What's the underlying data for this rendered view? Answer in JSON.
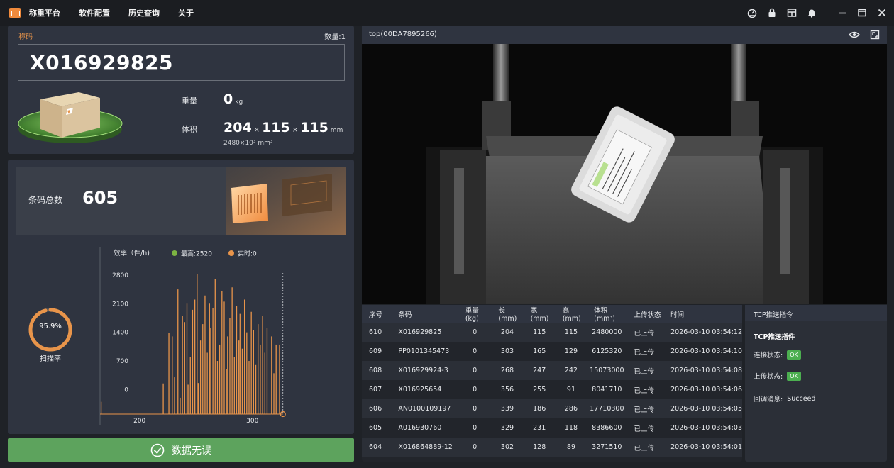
{
  "titlebar": {
    "menu": [
      "称重平台",
      "软件配置",
      "历史查询",
      "关于"
    ]
  },
  "barcode_panel": {
    "label": "称码",
    "count": "数量:1",
    "barcode": "X016929825",
    "weight_label": "重量",
    "weight_value": "0",
    "weight_unit": "kg",
    "volume_label": "体积",
    "length": "204",
    "width": "115",
    "height": "115",
    "dim_unit": "mm",
    "volume_sub": "2480×10³ mm³"
  },
  "stats": {
    "total_label": "条码总数",
    "total_value": "605",
    "scan_rate": "95.9%",
    "scan_rate_fraction": 0.959,
    "scan_rate_label": "扫描率"
  },
  "status_button": {
    "label": "数据无误"
  },
  "camera": {
    "title": "top(00DA7895266)"
  },
  "table": {
    "headers": [
      "序号",
      "条码",
      "重量(kg)",
      "长(mm)",
      "宽(mm)",
      "高(mm)",
      "体积(mm³)",
      "上传状态",
      "时间"
    ],
    "rows": [
      [
        "610",
        "X016929825",
        "0",
        "204",
        "115",
        "115",
        "2480000",
        "已上传",
        "2026-03-10 03:54:12"
      ],
      [
        "609",
        "PP0101345473",
        "0",
        "303",
        "165",
        "129",
        "6125320",
        "已上传",
        "2026-03-10 03:54:10"
      ],
      [
        "608",
        "X016929924-3",
        "0",
        "268",
        "247",
        "242",
        "15073000",
        "已上传",
        "2026-03-10 03:54:08"
      ],
      [
        "607",
        "X016925654",
        "0",
        "356",
        "255",
        "91",
        "8041710",
        "已上传",
        "2026-03-10 03:54:06"
      ],
      [
        "606",
        "AN0100109197",
        "0",
        "339",
        "186",
        "286",
        "17710300",
        "已上传",
        "2026-03-10 03:54:05"
      ],
      [
        "605",
        "A016930760",
        "0",
        "329",
        "231",
        "118",
        "8386600",
        "已上传",
        "2026-03-10 03:54:03"
      ],
      [
        "604",
        "X016864889-12",
        "0",
        "302",
        "128",
        "89",
        "3271510",
        "已上传",
        "2026-03-10 03:54:01"
      ]
    ]
  },
  "tcp": {
    "header": "TCP推送指令",
    "title": "TCP推送指件",
    "conn_label": "连接状态:",
    "conn_value": "OK",
    "upload_label": "上传状态:",
    "upload_value": "OK",
    "callback_label": "回调消息:",
    "callback_value": "Succeed"
  },
  "chart_data": {
    "type": "bar",
    "title": "效率（件/h)",
    "legend": [
      {
        "name": "最高:2520",
        "color": "#7cb342"
      },
      {
        "name": "实时:0",
        "color": "#e8944a"
      }
    ],
    "yticks": [
      "2800",
      "2100",
      "1400",
      "700",
      "0"
    ],
    "xticks": [
      {
        "label": "200",
        "x": 200
      },
      {
        "label": "300",
        "x": 300
      }
    ],
    "xlim": [
      165,
      385
    ],
    "ylim": [
      -600,
      2850
    ],
    "baseline": -600,
    "bars": [
      [
        166,
        -300
      ],
      [
        221,
        150
      ],
      [
        226,
        1380
      ],
      [
        229,
        1300
      ],
      [
        231,
        300
      ],
      [
        234,
        2450
      ],
      [
        236,
        -200
      ],
      [
        238,
        1800
      ],
      [
        240,
        1650
      ],
      [
        242,
        2100
      ],
      [
        243,
        120
      ],
      [
        245,
        800
      ],
      [
        247,
        1950
      ],
      [
        249,
        2200
      ],
      [
        251,
        2820
      ],
      [
        252,
        160
      ],
      [
        254,
        1200
      ],
      [
        256,
        1600
      ],
      [
        258,
        2300
      ],
      [
        260,
        900
      ],
      [
        262,
        2100
      ],
      [
        263,
        1500
      ],
      [
        265,
        2000
      ],
      [
        267,
        2700
      ],
      [
        269,
        700
      ],
      [
        271,
        1100
      ],
      [
        273,
        2400
      ],
      [
        275,
        2150
      ],
      [
        277,
        500
      ],
      [
        278,
        1300
      ],
      [
        280,
        1750
      ],
      [
        282,
        2500
      ],
      [
        284,
        800
      ],
      [
        286,
        2050
      ],
      [
        288,
        1200
      ],
      [
        289,
        1850
      ],
      [
        291,
        1000
      ],
      [
        293,
        2200
      ],
      [
        295,
        1400
      ],
      [
        297,
        700
      ],
      [
        299,
        1900
      ],
      [
        301,
        1450
      ],
      [
        303,
        600
      ],
      [
        305,
        1600
      ],
      [
        307,
        1100
      ],
      [
        309,
        1800
      ],
      [
        311,
        900
      ],
      [
        313,
        1500
      ],
      [
        317,
        1300
      ],
      [
        319,
        400
      ],
      [
        321,
        1100
      ],
      [
        324,
        1100
      ]
    ],
    "marker_x": 327
  }
}
